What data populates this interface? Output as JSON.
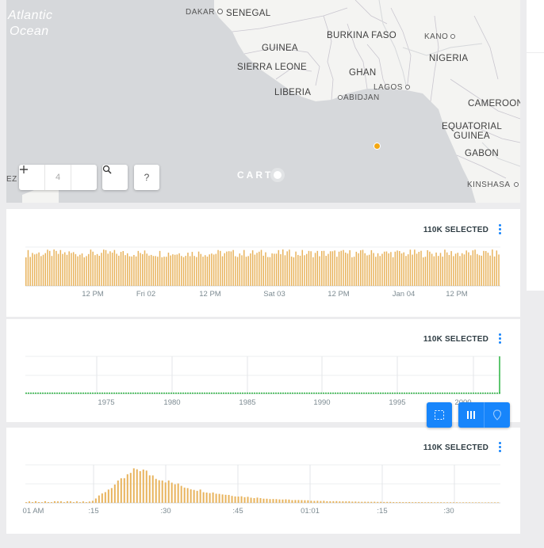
{
  "map": {
    "ocean_label_line1": "Atlantic",
    "ocean_label_line2": "Ocean",
    "places": {
      "senegal": "SENEGAL",
      "guinea": "GUINEA",
      "sierra_leone": "SIERRA LEONE",
      "liberia": "LIBERIA",
      "burkina_faso": "BURKINA FASO",
      "ghana": "GHAN",
      "nigeria": "NIGERIA",
      "cameroon": "CAMEROON",
      "eq_guinea_1": "EQUATORIAL",
      "eq_guinea_2": "GUINEA",
      "gabon": "GABON",
      "dakar": "DAKAR",
      "kano": "KANO",
      "lagos": "LAGOS",
      "abidjan": "ABIDJAN",
      "kinshasa": "KINSHASA",
      "edge_label": "EZ"
    },
    "zoom_level": "4",
    "zoom_out_icon": "minus-icon",
    "zoom_in_icon": "plus-icon",
    "search_icon": "search-icon",
    "help_label": "?",
    "logo": "CART",
    "colors": {
      "land": "#f4f4f2",
      "water": "#d6d8db",
      "point": "#f3a712"
    }
  },
  "widgets": [
    {
      "title": "110K SELECTED",
      "ticks": [
        "12 PM",
        "Fri 02",
        "12 PM",
        "Sat 03",
        "12 PM",
        "Jan 04",
        "12 PM"
      ],
      "color": "#e8b35c"
    },
    {
      "title": "110K SELECTED",
      "ticks": [
        "1975",
        "1980",
        "1985",
        "1990",
        "1995",
        "2000"
      ],
      "color": "#29b23f"
    },
    {
      "title": "110K SELECTED",
      "ticks": [
        "01 AM",
        ":15",
        ":30",
        ":45",
        "01:01",
        ":15",
        ":30"
      ],
      "color": "#e8b35c"
    }
  ],
  "tools": {
    "select_icon": "dashed-select-icon",
    "column_icon": "columns-icon",
    "pin_icon": "map-pin-icon",
    "accent": "#1785fb"
  }
}
